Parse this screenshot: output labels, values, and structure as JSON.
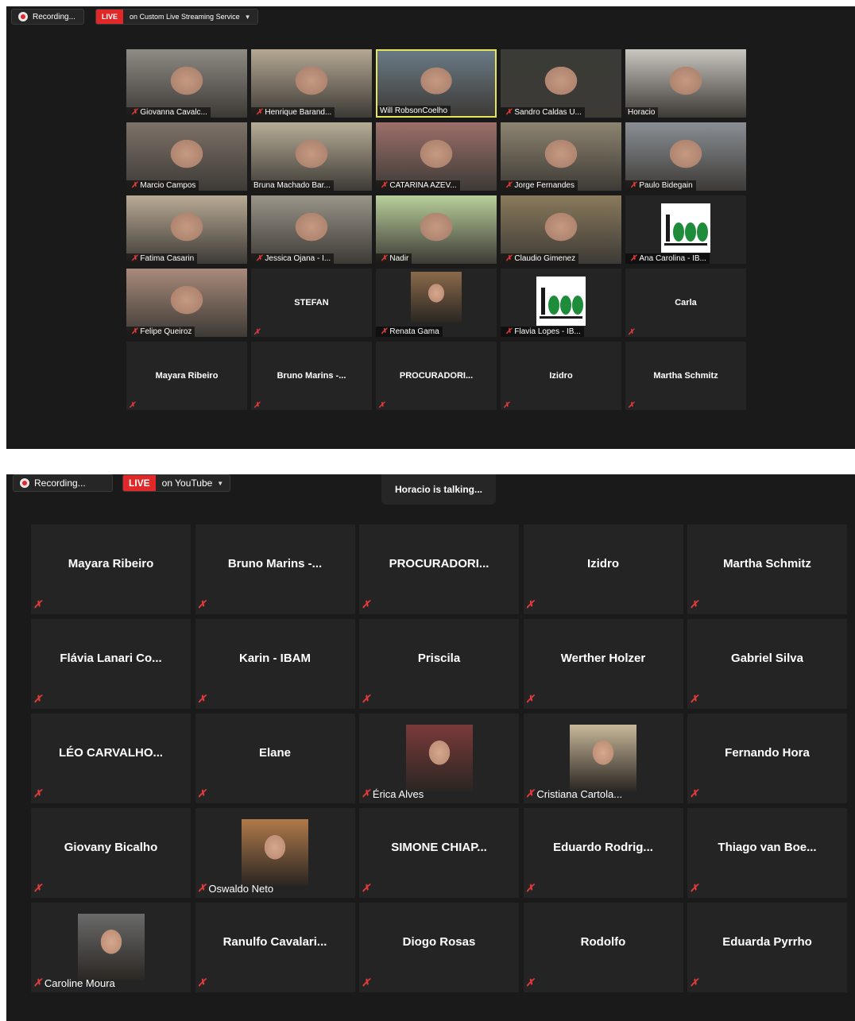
{
  "top": {
    "recording_label": "Recording...",
    "live_label": "LIVE",
    "live_target": "on Custom Live Streaming Service",
    "tiles": [
      {
        "name": "Giovanna Cavalc...",
        "kind": "video",
        "bg": "#8e8a84"
      },
      {
        "name": "Henrique Barand...",
        "kind": "video",
        "bg": "#b5a893"
      },
      {
        "name": "Will RobsonCoelho",
        "kind": "video",
        "bg": "#6a7a86",
        "speaking": true,
        "no_mic": true
      },
      {
        "name": "Sandro Caldas U...",
        "kind": "video",
        "bg": "#3a3b36"
      },
      {
        "name": "Horacio",
        "kind": "video",
        "bg": "#c9c6c0",
        "no_mic": true
      },
      {
        "name": "Marcio Campos",
        "kind": "video",
        "bg": "#7d7268"
      },
      {
        "name": "Bruna Machado Bar...",
        "kind": "video",
        "bg": "#b7ad96",
        "no_mic": true
      },
      {
        "name": "CATARINA AZEV...",
        "kind": "video",
        "bg": "#9c6f6a"
      },
      {
        "name": "Jorge Fernandes",
        "kind": "video",
        "bg": "#8d8470"
      },
      {
        "name": "Paulo Bidegain",
        "kind": "video",
        "bg": "#8a8f95"
      },
      {
        "name": "Fatima Casarin",
        "kind": "video",
        "bg": "#b9aa94"
      },
      {
        "name": "Jessica Ojana - I...",
        "kind": "video",
        "bg": "#9a9488"
      },
      {
        "name": "Nadir",
        "kind": "video",
        "bg": "#b8cf9a"
      },
      {
        "name": "Claudio Gimenez",
        "kind": "video",
        "bg": "#8a7a5c"
      },
      {
        "name": "Ana Carolina - IB...",
        "kind": "logo",
        "bg": "#242424"
      },
      {
        "name": "Felipe Queiroz",
        "kind": "video",
        "bg": "#a98a7a"
      },
      {
        "name": "STEFAN",
        "kind": "name"
      },
      {
        "name": "Renata Gama",
        "kind": "photo",
        "bg": "#8a6a4a"
      },
      {
        "name": "Flavia Lopes - IB...",
        "kind": "logo",
        "bg": "#242424"
      },
      {
        "name": "Carla",
        "kind": "name"
      },
      {
        "name": "Mayara Ribeiro",
        "kind": "name"
      },
      {
        "name": "Bruno Marins -...",
        "kind": "name"
      },
      {
        "name": "PROCURADORI...",
        "kind": "name"
      },
      {
        "name": "Izidro",
        "kind": "name"
      },
      {
        "name": "Martha Schmitz",
        "kind": "name"
      }
    ]
  },
  "bottom": {
    "recording_label": "Recording...",
    "live_label": "LIVE",
    "live_target": "on YouTube",
    "talking_label": "Horacio is talking...",
    "tiles": [
      {
        "name": "Mayara Ribeiro",
        "kind": "name"
      },
      {
        "name": "Bruno Marins -...",
        "kind": "name"
      },
      {
        "name": "PROCURADORI...",
        "kind": "name"
      },
      {
        "name": "Izidro",
        "kind": "name"
      },
      {
        "name": "Martha Schmitz",
        "kind": "name"
      },
      {
        "name": "Flávia Lanari Co...",
        "kind": "name"
      },
      {
        "name": "Karin - IBAM",
        "kind": "name"
      },
      {
        "name": "Priscila",
        "kind": "name"
      },
      {
        "name": "Werther Holzer",
        "kind": "name"
      },
      {
        "name": "Gabriel Silva",
        "kind": "name"
      },
      {
        "name": "LÉO CARVALHO...",
        "kind": "name"
      },
      {
        "name": "Elane",
        "kind": "name"
      },
      {
        "name": "Érica Alves",
        "kind": "photo",
        "bg": "#7a3a3a"
      },
      {
        "name": "Cristiana Cartola...",
        "kind": "photo",
        "bg": "#c8b89a"
      },
      {
        "name": "Fernando Hora",
        "kind": "name"
      },
      {
        "name": "Giovany Bicalho",
        "kind": "name"
      },
      {
        "name": "Oswaldo Neto",
        "kind": "photo",
        "bg": "#b07a4a"
      },
      {
        "name": "SIMONE CHIAP...",
        "kind": "name"
      },
      {
        "name": "Eduardo Rodrig...",
        "kind": "name"
      },
      {
        "name": "Thiago van Boe...",
        "kind": "name"
      },
      {
        "name": "Caroline Moura",
        "kind": "photo",
        "bg": "#6a6a6a"
      },
      {
        "name": "Ranulfo Cavalari...",
        "kind": "name"
      },
      {
        "name": "Diogo Rosas",
        "kind": "name"
      },
      {
        "name": "Rodolfo",
        "kind": "name"
      },
      {
        "name": "Eduarda Pyrrho",
        "kind": "name"
      }
    ]
  }
}
